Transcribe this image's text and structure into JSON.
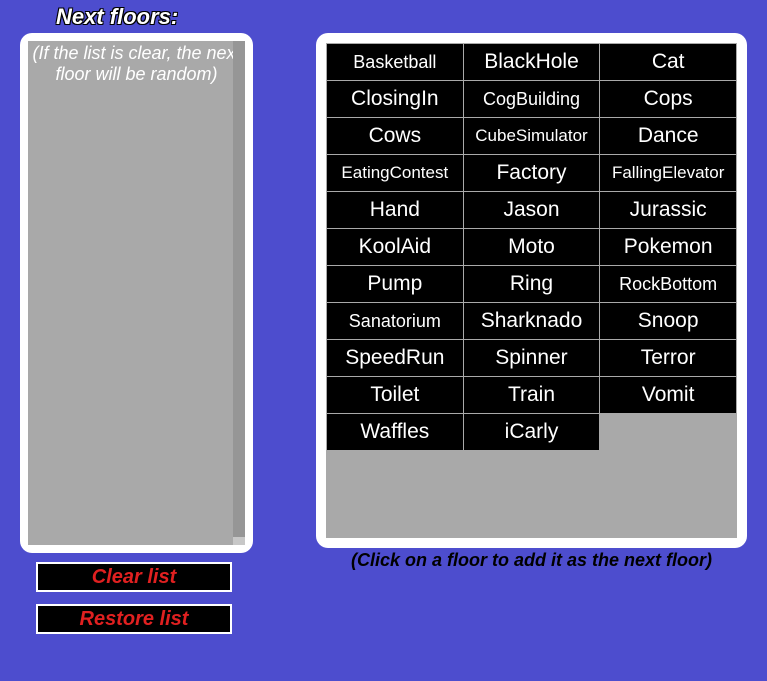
{
  "title": "Next floors:",
  "left_hint": "(If the list is clear, the next floor will be random)",
  "buttons": {
    "clear": "Clear list",
    "restore": "Restore list"
  },
  "floors": [
    "Basketball",
    "BlackHole",
    "Cat",
    "ClosingIn",
    "CogBuilding",
    "Cops",
    "Cows",
    "CubeSimulator",
    "Dance",
    "EatingContest",
    "Factory",
    "FallingElevator",
    "Hand",
    "Jason",
    "Jurassic",
    "KoolAid",
    "Moto",
    "Pokemon",
    "Pump",
    "Ring",
    "RockBottom",
    "Sanatorium",
    "Sharknado",
    "Snoop",
    "SpeedRun",
    "Spinner",
    "Terror",
    "Toilet",
    "Train",
    "Vomit",
    "Waffles",
    "iCarly"
  ],
  "right_hint": "(Click on a floor to add it as the next floor)"
}
